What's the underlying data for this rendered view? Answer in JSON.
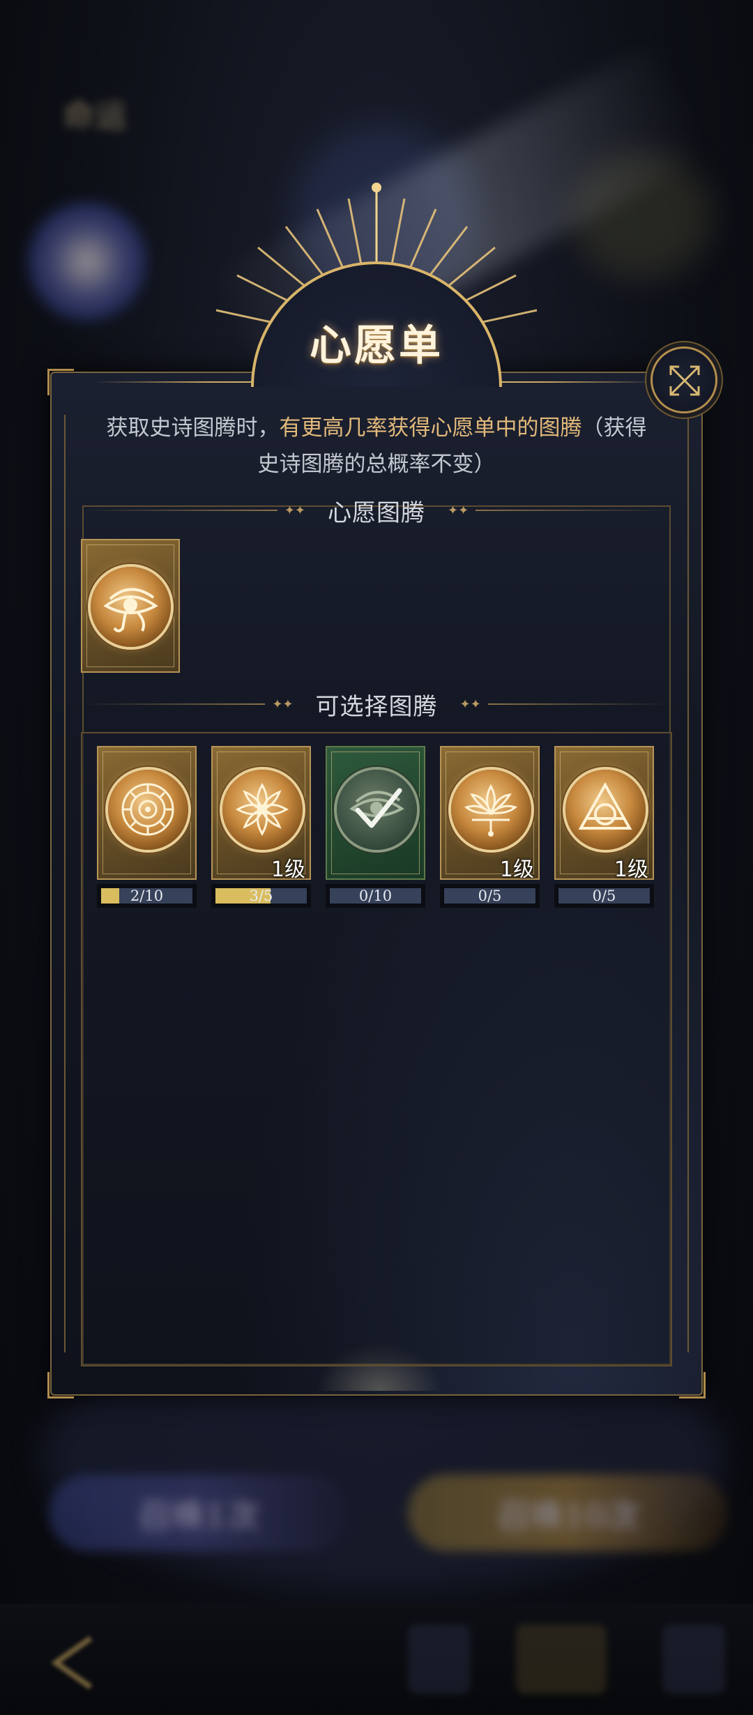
{
  "dialog": {
    "title": "心愿单",
    "description_plain_1": "获取史诗图腾时，",
    "description_highlight": "有更高几率获得心愿单中的图腾",
    "description_plain_2": "（获得史诗图腾的总概率不变）",
    "section_wishlist": "心愿图腾",
    "section_selectable": "可选择图腾"
  },
  "wishlist": [
    {
      "icon": "eye-of-horus-icon"
    }
  ],
  "totems": [
    {
      "icon": "rune-circle-icon",
      "level": "",
      "progress": "2/10",
      "fraction": 0.2,
      "color": "gold"
    },
    {
      "icon": "lotus-flower-icon",
      "level": "1级",
      "progress": "3/5",
      "fraction": 0.6,
      "color": "gold"
    },
    {
      "icon": "eye-of-horus-icon",
      "level": "",
      "progress": "0/10",
      "fraction": 0,
      "color": "green",
      "selected": true
    },
    {
      "icon": "lotus-bloom-icon",
      "level": "1级",
      "progress": "0/5",
      "fraction": 0,
      "color": "gold"
    },
    {
      "icon": "triangle-circle-icon",
      "level": "1级",
      "progress": "0/5",
      "fraction": 0,
      "color": "gold"
    }
  ],
  "background": {
    "top_title": "命运",
    "summon_one": "召唤1次",
    "summon_ten": "召唤10次",
    "medal_caption": "心愿单"
  },
  "colors": {
    "gold": "#d9b56a",
    "highlight": "#e2b97a",
    "progress_fill": "#d9bd5e",
    "progress_track": "#36415a"
  }
}
